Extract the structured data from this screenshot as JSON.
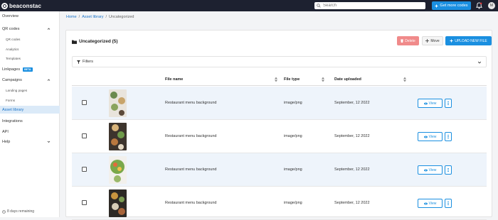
{
  "topbar": {
    "logo_text": "beaconstac",
    "search_placeholder": "Search",
    "get_codes_label": "Get more codes",
    "avatar_initials": "M"
  },
  "sidebar": {
    "items": [
      {
        "label": "Overview"
      },
      {
        "label": "QR codes"
      },
      {
        "label": "QR codes"
      },
      {
        "label": "Analytics"
      },
      {
        "label": "Templates"
      },
      {
        "label": "Linkpages",
        "badge": "BETA"
      },
      {
        "label": "Campaigns"
      },
      {
        "label": "Landing pages"
      },
      {
        "label": "Forms"
      },
      {
        "label": "Asset library"
      },
      {
        "label": "Integrations"
      },
      {
        "label": "API"
      },
      {
        "label": "Help"
      }
    ],
    "footer": "8 days remaining"
  },
  "breadcrumb": {
    "home": "Home",
    "sep1": "/",
    "library": "Asset library",
    "sep2": "/",
    "current": "Uncategorized"
  },
  "panel": {
    "title": "Uncategorized (5)",
    "delete_label": "Delete",
    "move_label": "Move",
    "upload_label": "UPLOAD NEW FILE",
    "filters_label": "Filters"
  },
  "table": {
    "headers": {
      "name": "File name",
      "type": "File type",
      "date": "Date uploaded"
    },
    "view_label": "View",
    "rows": [
      {
        "name": "Restaurant menu background",
        "type": "image/png",
        "date": "September, 12 2022"
      },
      {
        "name": "Restaurant menu background",
        "type": "image/png",
        "date": "September, 12 2022"
      },
      {
        "name": "Restaurant menu background",
        "type": "image/png",
        "date": "September, 12 2022"
      },
      {
        "name": "Restaurant menu background",
        "type": "image/png",
        "date": "September, 12 2022"
      }
    ]
  },
  "colors": {
    "accent": "#1a8fe0",
    "topbar": "#1d2130",
    "delete": "#f08a8a"
  }
}
